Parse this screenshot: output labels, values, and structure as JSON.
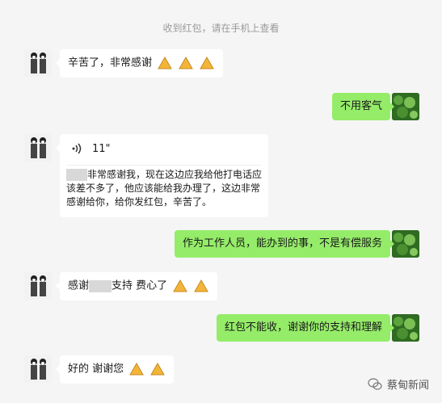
{
  "system_notice": "收到红包，请在手机上查看",
  "messages": [
    {
      "side": "left",
      "text": "辛苦了，非常感谢",
      "emoji_count": 3
    },
    {
      "side": "right",
      "text": "不用客气"
    },
    {
      "side": "left",
      "type": "voice",
      "duration": "11\"",
      "transcript_after_redaction": "非常感谢我，现在这边应我给他打电话应该差不多了，他应该能给我办理了，这边非常感谢给你，给你发红包，辛苦了。"
    },
    {
      "side": "right",
      "text": "作为工作人员，能办到的事，不是有偿服务"
    },
    {
      "side": "left",
      "text_before": "感谢",
      "text_after": "支持 费心了",
      "emoji_count": 2
    },
    {
      "side": "right",
      "text": "红包不能收，谢谢你的支持和理解"
    },
    {
      "side": "left",
      "text": "好的 谢谢您",
      "emoji_count": 2
    }
  ],
  "watermark": "蔡甸新闻",
  "icons": {
    "emoji": "folded-hands-icon",
    "voice": "voice-wave-icon",
    "watermark": "wechat-icon"
  },
  "colors": {
    "background": "#f5f5f5",
    "incoming_bubble": "#ffffff",
    "outgoing_bubble": "#95ec69"
  }
}
